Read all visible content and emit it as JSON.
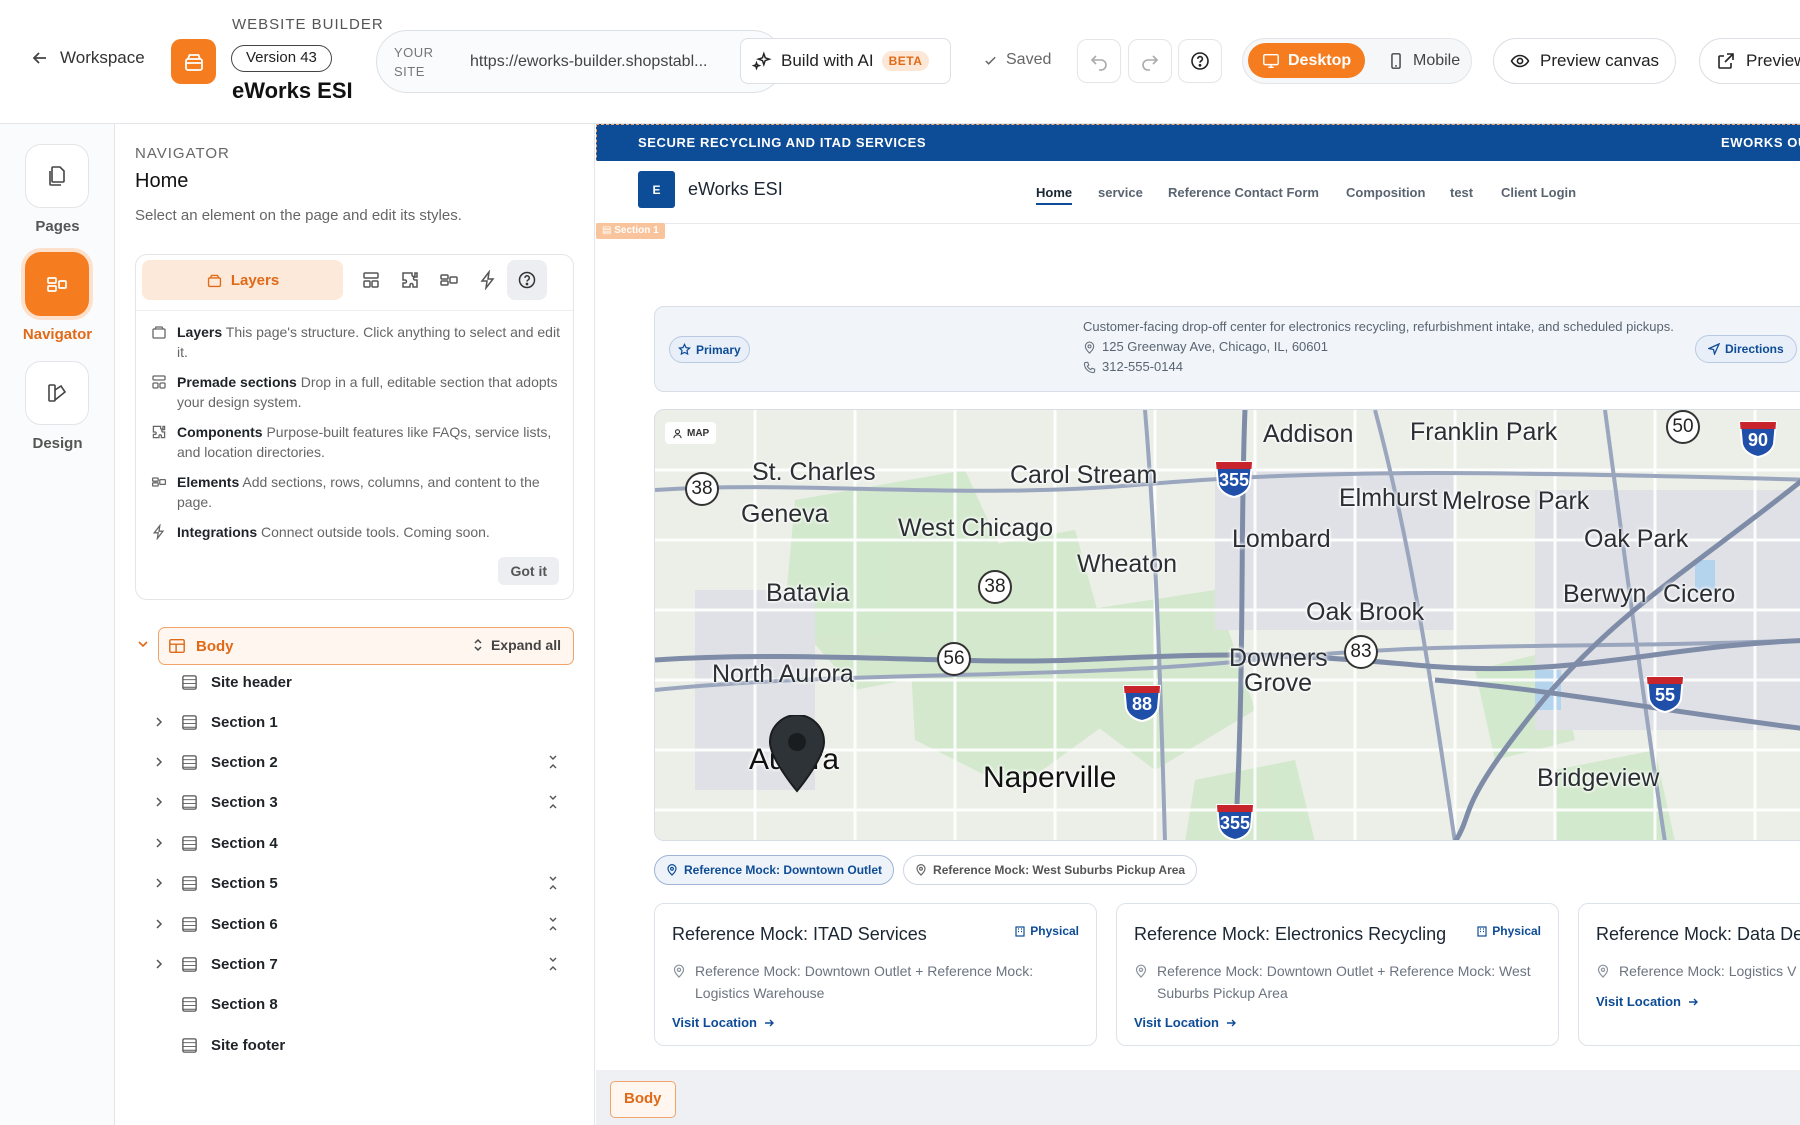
{
  "topbar": {
    "back_label": "Workspace",
    "builder_label": "WEBSITE BUILDER",
    "version": "Version 43",
    "site_name": "eWorks ESI",
    "your_site_label": "YOUR SITE",
    "site_url": "https://eworks-builder.shopstabl...",
    "build_ai_label": "Build with AI",
    "beta_label": "BETA",
    "saved_label": "Saved",
    "desktop_label": "Desktop",
    "mobile_label": "Mobile",
    "preview_canvas_label": "Preview canvas",
    "preview_label": "Preview",
    "accent_color": "#f57c1f"
  },
  "rail": {
    "items": [
      {
        "label": "Pages",
        "icon": "pages-icon"
      },
      {
        "label": "Navigator",
        "icon": "navigator-icon",
        "active": true
      },
      {
        "label": "Design",
        "icon": "design-icon"
      }
    ]
  },
  "navigator": {
    "kicker": "NAVIGATOR",
    "title": "Home",
    "description": "Select an element on the page and edit its styles.",
    "layers_tab": "Layers",
    "help": [
      {
        "title": "Layers",
        "text": " This page's structure. Click anything to select and edit it."
      },
      {
        "title": "Premade sections",
        "text": " Drop in a full, editable section that adopts your design system."
      },
      {
        "title": "Components",
        "text": " Purpose-built features like FAQs, service lists, and location directories."
      },
      {
        "title": "Elements",
        "text": " Add sections, rows, columns, and content to the page."
      },
      {
        "title": "Integrations",
        "text": " Connect outside tools. Coming soon."
      }
    ],
    "got_it": "Got it",
    "body_label": "Body",
    "expand_all": "Expand all",
    "tree": [
      {
        "label": "Site header",
        "expandable": false,
        "collapsible": false
      },
      {
        "label": "Section 1",
        "expandable": true,
        "collapsible": false
      },
      {
        "label": "Section 2",
        "expandable": true,
        "collapsible": true
      },
      {
        "label": "Section 3",
        "expandable": true,
        "collapsible": true
      },
      {
        "label": "Section 4",
        "expandable": true,
        "collapsible": false
      },
      {
        "label": "Section 5",
        "expandable": true,
        "collapsible": true
      },
      {
        "label": "Section 6",
        "expandable": true,
        "collapsible": true
      },
      {
        "label": "Section 7",
        "expandable": true,
        "collapsible": true
      },
      {
        "label": "Section 8",
        "expandable": false,
        "collapsible": false
      },
      {
        "label": "Site footer",
        "expandable": false,
        "collapsible": false
      }
    ]
  },
  "canvas": {
    "announcement": "SECURE RECYCLING AND ITAD SERVICES",
    "announcement_right": "EWORKS OU",
    "logo_letter": "E",
    "brand": "eWorks ESI",
    "nav": [
      "Home",
      "service",
      "Reference Contact Form",
      "Composition",
      "test",
      "Client Login"
    ],
    "section_tag": "Section 1",
    "brand_color": "#0d4c96",
    "location": {
      "primary_label": "Primary",
      "description": "Customer-facing drop-off center for electronics recycling, refurbishment intake, and scheduled pickups.",
      "address": "125 Greenway Ave, Chicago, IL, 60601",
      "phone": "312-555-0144",
      "directions_label": "Directions"
    },
    "map": {
      "chip": "MAP",
      "cities": [
        "Addison",
        "Franklin Park",
        "St. Charles",
        "Carol Stream",
        "Elmhurst",
        "Melrose Park",
        "Geneva",
        "West Chicago",
        "Lombard",
        "Oak Park",
        "Wheaton",
        "Batavia",
        "Berwyn",
        "Cicero",
        "Oak Brook",
        "Downers",
        "Grove",
        "North Aurora",
        "Aurora",
        "Naperville",
        "Bridgeview"
      ],
      "route_shields": [
        "38",
        "355",
        "50",
        "90",
        "38",
        "56",
        "83",
        "88",
        "55",
        "355"
      ]
    },
    "location_tabs": [
      "Reference Mock: Downtown Outlet",
      "Reference Mock: West Suburbs Pickup Area"
    ],
    "services": [
      {
        "title": "Reference Mock: ITAD Services",
        "badge": "Physical",
        "locations": "Reference Mock: Downtown Outlet + Reference Mock: Logistics Warehouse",
        "link": "Visit Location"
      },
      {
        "title": "Reference Mock: Electronics Recycling",
        "badge": "Physical",
        "locations": "Reference Mock: Downtown Outlet + Reference Mock: West Suburbs Pickup Area",
        "link": "Visit Location"
      },
      {
        "title": "Reference Mock: Data De",
        "badge": "",
        "locations": "Reference Mock: Logistics V",
        "link": "Visit Location"
      }
    ],
    "body_chip": "Body"
  }
}
